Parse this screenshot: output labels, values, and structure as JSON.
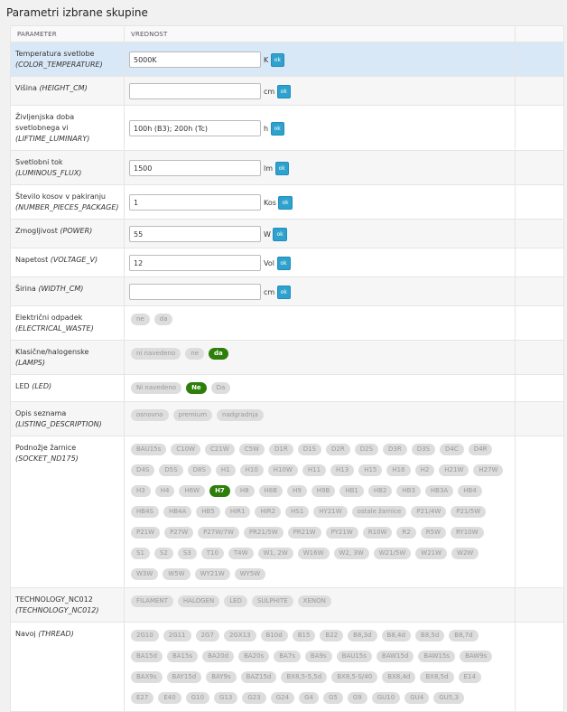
{
  "title": "Parametri izbrane skupine",
  "headers": {
    "param": "PARAMETER",
    "value": "VREDNOST"
  },
  "ok_label": "ok",
  "inputs": [
    {
      "name": "Temperatura svetlobe",
      "code": "(COLOR_TEMPERATURE)",
      "value": "5000K",
      "unit": "K"
    },
    {
      "name": "Višina",
      "code": "(HEIGHT_CM)",
      "value": "",
      "unit": "cm"
    },
    {
      "name": "Življenjska doba svetlobnega vi",
      "code": "(LIFTIME_LUMINARY)",
      "value": "100h (B3); 200h (Tc)",
      "unit": "h"
    },
    {
      "name": "Svetlobni tok",
      "code": "(LUMINOUS_FLUX)",
      "value": "1500",
      "unit": "lm"
    },
    {
      "name": "Število kosov v pakiranju",
      "code": "(NUMBER_PIECES_PACKAGE)",
      "value": "1",
      "unit": "Kos"
    },
    {
      "name": "Zmogljivost",
      "code": "(POWER)",
      "value": "55",
      "unit": "W"
    },
    {
      "name": "Napetost",
      "code": "(VOLTAGE_V)",
      "value": "12",
      "unit": "Vol"
    },
    {
      "name": "Širina",
      "code": "(WIDTH_CM)",
      "value": "",
      "unit": "cm"
    }
  ],
  "options": [
    {
      "name": "Električni odpadek",
      "code": "(ELECTRICAL_WASTE)",
      "chips": [
        "ne",
        "da"
      ],
      "selected": []
    },
    {
      "name": "Klasične/halogenske",
      "code": "(LAMPS)",
      "chips": [
        "ni navedeno",
        "ne",
        "da"
      ],
      "selected": [
        "da"
      ]
    },
    {
      "name": "LED",
      "code": "(LED)",
      "chips": [
        "Ni navedeno",
        "Ne",
        "Da"
      ],
      "selected": [
        "Ne"
      ]
    },
    {
      "name": "Opis seznama",
      "code": "(LISTING_DESCRIPTION)",
      "chips": [
        "osnovno",
        "premium",
        "nadgradnja"
      ],
      "selected": []
    },
    {
      "name": "Podnožje žarnice",
      "code": "(SOCKET_ND175)",
      "chips": [
        "BAU15s",
        "C10W",
        "C21W",
        "C5W",
        "D1R",
        "D1S",
        "D2R",
        "D2S",
        "D3R",
        "D3S",
        "D4C",
        "D4R",
        "D4S",
        "D5S",
        "D8S",
        "H1",
        "H10",
        "H10W",
        "H11",
        "H13",
        "H15",
        "H16",
        "H2",
        "H21W",
        "H27W",
        "H3",
        "H4",
        "H6W",
        "H7",
        "H8",
        "H8B",
        "H9",
        "H9B",
        "HB1",
        "HB2",
        "HB3",
        "HB3A",
        "HB4",
        "HB4S",
        "HB4A",
        "HB5",
        "HIR1",
        "HIR2",
        "HS1",
        "HY21W",
        "ostale žarnice",
        "P21/4W",
        "P21/5W",
        "P21W",
        "P27W",
        "P27W/7W",
        "PR21/5W",
        "PR21W",
        "PY21W",
        "R10W",
        "R2",
        "R5W",
        "RY10W",
        "S1",
        "S2",
        "S3",
        "T10",
        "T4W",
        "W1, 2W",
        "W16W",
        "W2, 3W",
        "W21/5W",
        "W21W",
        "W2W",
        "W3W",
        "W5W",
        "WY21W",
        "WY5W"
      ],
      "selected": [
        "H7"
      ]
    },
    {
      "name": "TECHNOLOGY_NC012",
      "code": "(TECHNOLOGY_NC012)",
      "chips": [
        "FILAMENT",
        "HALOGEN",
        "LED",
        "SULPHITE",
        "XENON"
      ],
      "selected": []
    },
    {
      "name": "Navoj",
      "code": "(THREAD)",
      "chips": [
        "2G10",
        "2G11",
        "2G7",
        "2GX13",
        "B10d",
        "B15",
        "B22",
        "B8,3d",
        "B8,4d",
        "B8,5d",
        "B8,7d",
        "BA15d",
        "BA15s",
        "BA20d",
        "BA20s",
        "BA7s",
        "BA9s",
        "BAU15s",
        "BAW15d",
        "BAW15s",
        "BAW9s",
        "BAX9s",
        "BAY15d",
        "BAY9s",
        "BAZ15d",
        "BX8,5-5,5d",
        "BX8,5-S/40",
        "BX8,4d",
        "BX8,5d",
        "E14",
        "E27",
        "E40",
        "G10",
        "G13",
        "G23",
        "G24",
        "G4",
        "G5",
        "G9",
        "GU10",
        "GU4",
        "GU5,3"
      ],
      "selected": []
    }
  ],
  "colors": {
    "accent": "#2ea2cc",
    "selected": "#2d7e0a",
    "highlight": "#d9e8f7"
  }
}
